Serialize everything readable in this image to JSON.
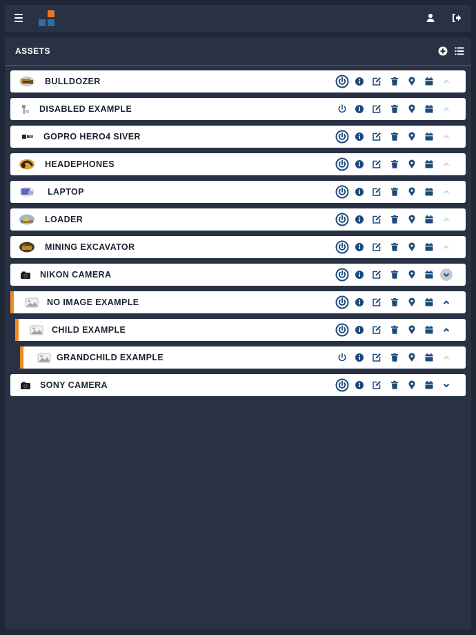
{
  "app": {
    "menu_icon": "hamburger-icon",
    "logo": {
      "colors": [
        "#e8772e",
        "#2f6ea3",
        "#2f6ea3",
        "#2f6ea3"
      ]
    },
    "user_icon": "user-icon",
    "logout_icon": "sign-out-icon"
  },
  "panel": {
    "title": "ASSETS",
    "add_icon": "plus-circle-icon",
    "list_icon": "list-icon"
  },
  "colors": {
    "accent": "#f08a24",
    "icon_navy": "#1b4a7a",
    "background": "#1f2736",
    "panel": "#283244"
  },
  "assets": [
    {
      "label": "BULLDOZER",
      "thumb": "bulldozer-thumbnail",
      "power": "on",
      "expand": "up",
      "level": 0
    },
    {
      "label": "DISABLED EXAMPLE",
      "thumb": "disabled-thumbnail",
      "power": "off",
      "expand": "up",
      "level": 0
    },
    {
      "label": "GOPRO HERO4 SIVER",
      "thumb": "gopro-thumbnail",
      "power": "on",
      "expand": "up",
      "level": 0
    },
    {
      "label": "HEADEPHONES",
      "thumb": "headphones-thumbnail",
      "power": "on",
      "expand": "up",
      "level": 0
    },
    {
      "label": "LAPTOP",
      "thumb": "laptop-thumbnail",
      "power": "on",
      "expand": "up",
      "level": 0
    },
    {
      "label": "LOADER",
      "thumb": "loader-thumbnail",
      "power": "on",
      "expand": "up",
      "level": 0
    },
    {
      "label": "MINING EXCAVATOR",
      "thumb": "excavator-thumbnail",
      "power": "on",
      "expand": "up",
      "level": 0
    },
    {
      "label": "NIKON CAMERA",
      "thumb": "camera-thumbnail",
      "power": "on",
      "expand": "down-active",
      "level": 0
    },
    {
      "label": "NO IMAGE EXAMPLE",
      "thumb": "placeholder-image",
      "power": "on",
      "expand": "up-dark",
      "level": 1
    },
    {
      "label": "CHILD EXAMPLE",
      "thumb": "placeholder-image",
      "power": "on",
      "expand": "up-dark",
      "level": 2
    },
    {
      "label": "GRANDCHILD EXAMPLE",
      "thumb": "placeholder-image",
      "power": "off",
      "expand": "up",
      "level": 3
    },
    {
      "label": "SONY CAMERA",
      "thumb": "camera-thumbnail",
      "power": "on",
      "expand": "down",
      "level": 0
    }
  ],
  "row_actions": [
    "info-icon",
    "edit-icon",
    "trash-icon",
    "map-marker-icon",
    "calendar-icon"
  ]
}
